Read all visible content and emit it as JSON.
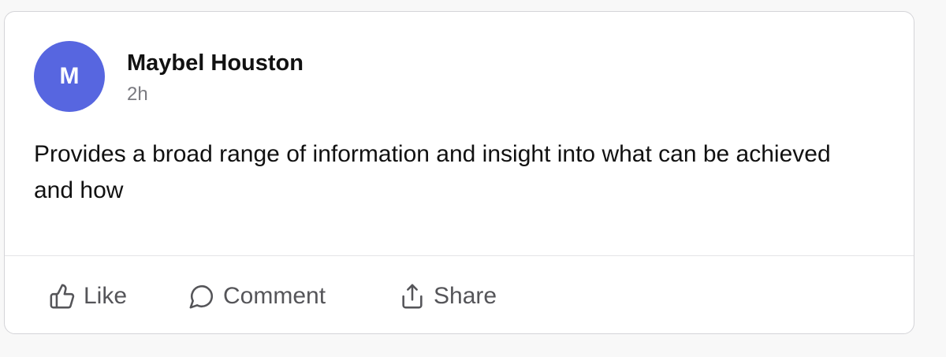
{
  "post": {
    "author": {
      "initial": "M",
      "name": "Maybel Houston",
      "avatar_color": "#5766e0"
    },
    "time": "2h",
    "body": "Provides a broad range of information and insight into what can be achieved and how"
  },
  "actions": {
    "like": {
      "label": "Like",
      "icon": "thumbs-up-icon"
    },
    "comment": {
      "label": "Comment",
      "icon": "speech-bubble-icon"
    },
    "share": {
      "label": "Share",
      "icon": "share-upload-icon"
    }
  }
}
